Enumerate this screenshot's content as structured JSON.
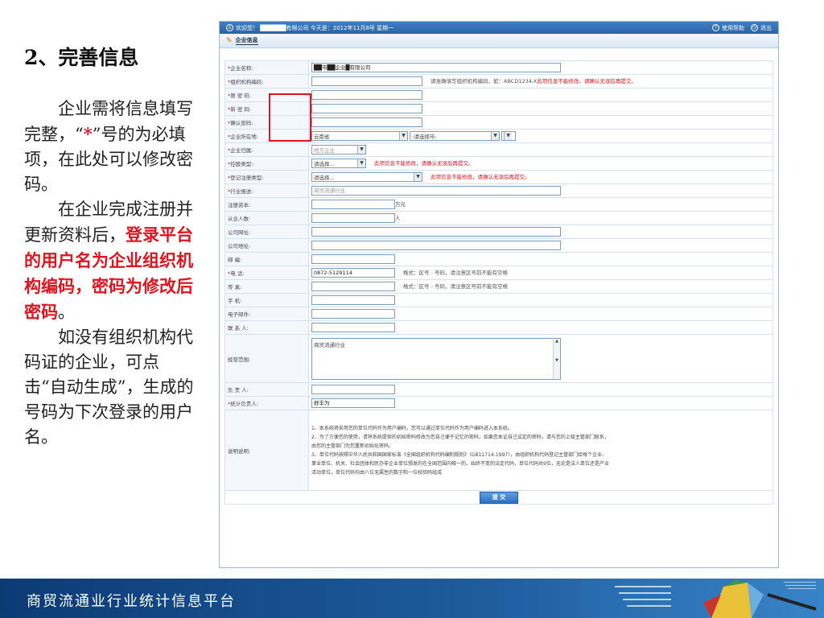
{
  "left": {
    "heading": "2、完善信息",
    "p1_a": "企业需将信息填写完整，",
    "p1_q1": "“",
    "p1_star": "*",
    "p1_q2": "”号的为必填项，在此处可以修改密码。",
    "p2_a": "在企业完成注册并更新资料后，",
    "p2_red": "登录平台的用户名为企业组织机构编码，密码为修改后密码",
    "p2_end": "。",
    "p3": "如没有组织机构代码证的企业，可点击“自动生成”，生成的号码为下次登录的用户名。"
  },
  "shot": {
    "topbar_welcome": "欢迎您！  ██████有限公司  今天是：2012年11月8号 星期一",
    "help_label": "使用帮助",
    "exit_label": "退出",
    "tab_label": "企业信息",
    "rows": {
      "company_name": {
        "label": "*企业名称:",
        "value": "██市██企业█有限公司"
      },
      "org_code": {
        "label": "*组织机构编码:",
        "hint": "请准确填写组织机构编码，如：ABCD1234-X",
        "warn": "此项信息不能修改，请确认无误后再提交。"
      },
      "old_pwd": {
        "label": "*原 密 码:"
      },
      "new_pwd": {
        "label": "*新 密 码:"
      },
      "confirm_pwd": {
        "label": "*确认密码:"
      },
      "location": {
        "label": "*企业所在地:",
        "province": "云南省",
        "city": "-请选择市-"
      },
      "group": {
        "label": "*企业归属:",
        "value": "地方企业"
      },
      "holding": {
        "label": "*控股类型:",
        "value": "请选择...",
        "warn": "此项信息不能修改，请确认无误后再提交。"
      },
      "reg_type": {
        "label": "*登记注册类型:",
        "value": "请选择...",
        "warn": "此项信息不能修改，请确认无误后再提交。"
      },
      "industry": {
        "label": "*行业报送:",
        "value": "商贸流通行业"
      },
      "capital": {
        "label": "注册资本:",
        "unit": "万元"
      },
      "employees": {
        "label": "从业人数:",
        "unit": "人"
      },
      "website": {
        "label": "公司网址:"
      },
      "address": {
        "label": "公司地址:"
      },
      "postcode": {
        "label": "邮    编:"
      },
      "phone": {
        "label": "*电    话:",
        "value": "0872-5129114",
        "hint": "格式：区号 - 号码，请注意区号前不能有空格"
      },
      "fax": {
        "label": "传    真:",
        "hint": "格式：区号 - 号码，请注意区号前不能有空格"
      },
      "mobile": {
        "label": "手    机:"
      },
      "email": {
        "label": "电子邮件:"
      },
      "contact": {
        "label": "联 系 人:"
      },
      "scope": {
        "label": "经营范围:",
        "value": "商贸流通行业"
      },
      "manager": {
        "label": "负 责 人:"
      },
      "stat_owner": {
        "label": "*统计负责人:",
        "value": "舒丰为"
      }
    },
    "notes_label": "说明说明:",
    "notes": [
      "1、本系统将采用您的单位代码作为用户编码，您可以通过单位代码作为用户编码进入本系统。",
      "2、为了方便您的使用，请将系统提供的初始密码修改为您自己便于记忆的密码，如果您本证自己设定的密码，请与您的上级主管部门联系，",
      "   由您的主管部门为您重新初始化密码。",
      "3、单位代码按照中华人民共和国国家标准《全国组织机构代码编制规则》（GB11714-1997），由组织机构代码登记主管部门给每个企业、",
      "   事业单位、机关、社会团体和民办非企业单位颁发的在全国范围内唯一的、始终不变的法定代码，单位代码共9位，无论是法人单位还是产业",
      "   活动单位，单位代码均由八位无属性的数字和一位校验码组成"
    ],
    "submit_label": "提 交"
  },
  "footer": {
    "title": "商贸流通业行业统计信息平台"
  }
}
